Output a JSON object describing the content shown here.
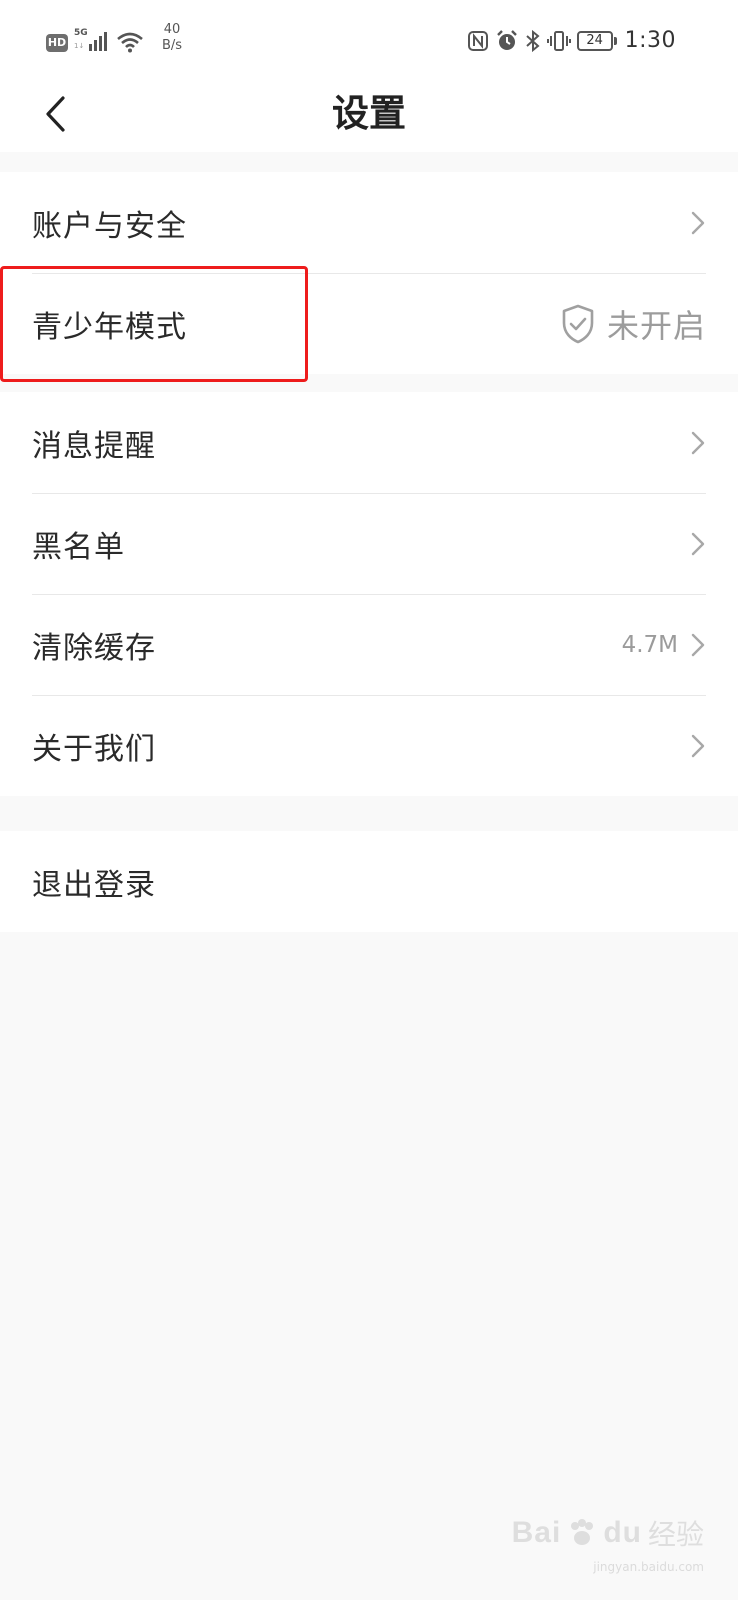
{
  "status_bar": {
    "hd_badge": "HD",
    "network_label": "5G",
    "network_sub": "1↓",
    "speed_value": "40",
    "speed_unit": "B/s",
    "battery_level": "24",
    "time": "1:30",
    "icons": [
      "nfc-icon",
      "alarm-icon",
      "bluetooth-icon",
      "vibrate-icon",
      "battery-icon"
    ]
  },
  "header": {
    "title": "设置",
    "back_icon": "chevron-left-icon"
  },
  "groups": [
    {
      "items": [
        {
          "label": "账户与安全",
          "right_icon": "chevron-right-icon"
        },
        {
          "label": "青少年模式",
          "status": "未开启",
          "status_icon": "shield-check-icon"
        }
      ]
    },
    {
      "items": [
        {
          "label": "消息提醒",
          "right_icon": "chevron-right-icon"
        },
        {
          "label": "黑名单",
          "right_icon": "chevron-right-icon"
        },
        {
          "label": "清除缓存",
          "value": "4.7M",
          "right_icon": "chevron-right-icon"
        },
        {
          "label": "关于我们",
          "right_icon": "chevron-right-icon"
        }
      ]
    },
    {
      "items": [
        {
          "label": "退出登录"
        }
      ]
    }
  ],
  "highlight": {
    "color": "#ee1c1c"
  },
  "watermark": {
    "brand": "Bai",
    "brand_suffix": "du",
    "text": "经验",
    "url": "jingyan.baidu.com"
  }
}
